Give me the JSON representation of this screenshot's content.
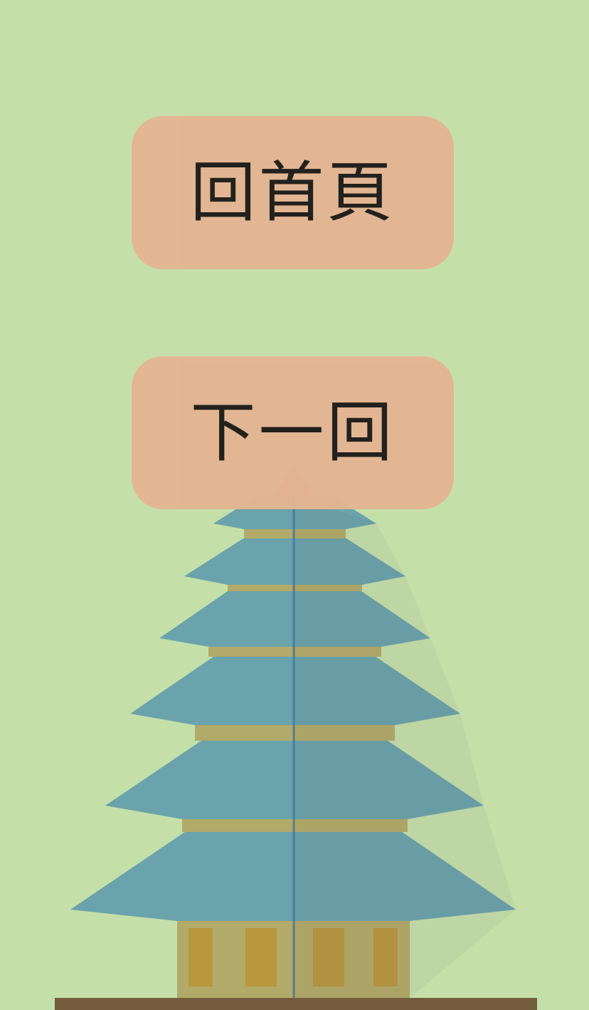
{
  "buttons": {
    "home_label": "回首頁",
    "next_label": "下一回"
  },
  "illustration": {
    "subject": "pagoda-illustration",
    "tiers": 6
  },
  "colors": {
    "background": "#c4e0a8",
    "button": "#e4b592",
    "roof": "#6aa3ab",
    "wall": "#b2aa68",
    "door": "#b8973e",
    "ground": "#735b3c"
  }
}
